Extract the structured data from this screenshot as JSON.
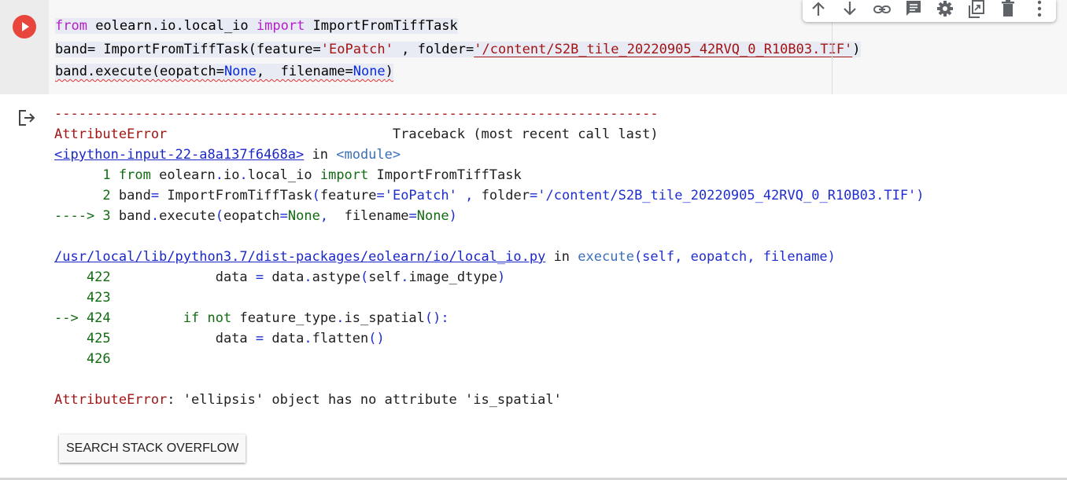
{
  "code_cell": {
    "lines": [
      [
        {
          "t": "from",
          "c": "kw"
        },
        {
          "t": " eolearn.io.local_io ",
          "c": "plain"
        },
        {
          "t": "import",
          "c": "kw"
        },
        {
          "t": " ImportFromTiffTask",
          "c": "plain"
        }
      ],
      [
        {
          "t": "band= ImportFromTiffTask(feature=",
          "c": "plain"
        },
        {
          "t": "'EoPatch'",
          "c": "str"
        },
        {
          "t": " , folder=",
          "c": "plain"
        },
        {
          "t": "'/content/S2B_tile_20220905_42RVQ_0_R10B03.TIF'",
          "c": "str err-ul"
        },
        {
          "t": ")",
          "c": "plain"
        }
      ],
      [
        {
          "t": "band.execute(eopatch=",
          "c": "plain squig"
        },
        {
          "t": "None",
          "c": "none squig"
        },
        {
          "t": ",  filename=",
          "c": "plain squig"
        },
        {
          "t": "None",
          "c": "none squig"
        },
        {
          "t": ")",
          "c": "plain squig"
        }
      ]
    ]
  },
  "toolbar": {
    "icons": [
      "arrow-up-icon",
      "arrow-down-icon",
      "link-icon",
      "comment-icon",
      "gear-icon",
      "mirror-cell-icon",
      "trash-icon",
      "more-vert-icon"
    ]
  },
  "output": {
    "lines": [
      [
        {
          "t": "---------------------------------------------------------------------------",
          "c": "o-red"
        }
      ],
      [
        {
          "t": "AttributeError",
          "c": "o-red"
        },
        {
          "t": "                            Traceback (most recent call last)",
          "c": "o-dark"
        }
      ],
      [
        {
          "t": "<ipython-input-22-a8a137f6468a>",
          "c": "o-link"
        },
        {
          "t": " in ",
          "c": "o-dark"
        },
        {
          "t": "<module>",
          "c": "o-teal"
        }
      ],
      [
        {
          "t": "      1 ",
          "c": "o-green"
        },
        {
          "t": "from",
          "c": "o-green"
        },
        {
          "t": " eolearn",
          "c": "o-dark"
        },
        {
          "t": ".",
          "c": "o-blue"
        },
        {
          "t": "io",
          "c": "o-dark"
        },
        {
          "t": ".",
          "c": "o-blue"
        },
        {
          "t": "local_io ",
          "c": "o-dark"
        },
        {
          "t": "import",
          "c": "o-green"
        },
        {
          "t": " ImportFromTiffTask",
          "c": "o-dark"
        }
      ],
      [
        {
          "t": "      2 ",
          "c": "o-green"
        },
        {
          "t": "band",
          "c": "o-dark"
        },
        {
          "t": "=",
          "c": "o-blue"
        },
        {
          "t": " ImportFromTiffTask",
          "c": "o-dark"
        },
        {
          "t": "(",
          "c": "o-blue"
        },
        {
          "t": "feature",
          "c": "o-dark"
        },
        {
          "t": "=",
          "c": "o-blue"
        },
        {
          "t": "'EoPatch'",
          "c": "o-blue"
        },
        {
          "t": " ",
          "c": "o-dark"
        },
        {
          "t": ",",
          "c": "o-blue"
        },
        {
          "t": " folder",
          "c": "o-dark"
        },
        {
          "t": "=",
          "c": "o-blue"
        },
        {
          "t": "'/content/S2B_tile_20220905_42RVQ_0_R10B03.TIF'",
          "c": "o-blue"
        },
        {
          "t": ")",
          "c": "o-blue"
        }
      ],
      [
        {
          "t": "----> 3 ",
          "c": "o-green"
        },
        {
          "t": "band",
          "c": "o-dark"
        },
        {
          "t": ".",
          "c": "o-blue"
        },
        {
          "t": "execute",
          "c": "o-dark"
        },
        {
          "t": "(",
          "c": "o-blue"
        },
        {
          "t": "eopatch",
          "c": "o-dark"
        },
        {
          "t": "=",
          "c": "o-blue"
        },
        {
          "t": "None",
          "c": "o-green"
        },
        {
          "t": ",",
          "c": "o-blue"
        },
        {
          "t": "  filename",
          "c": "o-dark"
        },
        {
          "t": "=",
          "c": "o-blue"
        },
        {
          "t": "None",
          "c": "o-green"
        },
        {
          "t": ")",
          "c": "o-blue"
        }
      ],
      [],
      [
        {
          "t": "/usr/local/lib/python3.7/dist-packages/eolearn/io/local_io.py",
          "c": "o-link"
        },
        {
          "t": " in ",
          "c": "o-dark"
        },
        {
          "t": "execute",
          "c": "o-teal"
        },
        {
          "t": "(self, eopatch, filename)",
          "c": "o-blue"
        }
      ],
      [
        {
          "t": "    422 ",
          "c": "o-green"
        },
        {
          "t": "            data ",
          "c": "o-dark"
        },
        {
          "t": "=",
          "c": "o-blue"
        },
        {
          "t": " data",
          "c": "o-dark"
        },
        {
          "t": ".",
          "c": "o-blue"
        },
        {
          "t": "astype",
          "c": "o-dark"
        },
        {
          "t": "(",
          "c": "o-blue"
        },
        {
          "t": "self",
          "c": "o-dark"
        },
        {
          "t": ".",
          "c": "o-blue"
        },
        {
          "t": "image_dtype",
          "c": "o-dark"
        },
        {
          "t": ")",
          "c": "o-blue"
        }
      ],
      [
        {
          "t": "    423 ",
          "c": "o-green"
        }
      ],
      [
        {
          "t": "--> 424 ",
          "c": "o-green"
        },
        {
          "t": "        ",
          "c": "o-dark"
        },
        {
          "t": "if",
          "c": "o-green"
        },
        {
          "t": " ",
          "c": "o-dark"
        },
        {
          "t": "not",
          "c": "o-green"
        },
        {
          "t": " feature_type",
          "c": "o-dark"
        },
        {
          "t": ".",
          "c": "o-blue"
        },
        {
          "t": "is_spatial",
          "c": "o-dark"
        },
        {
          "t": "():",
          "c": "o-blue"
        }
      ],
      [
        {
          "t": "    425 ",
          "c": "o-green"
        },
        {
          "t": "            data ",
          "c": "o-dark"
        },
        {
          "t": "=",
          "c": "o-blue"
        },
        {
          "t": " data",
          "c": "o-dark"
        },
        {
          "t": ".",
          "c": "o-blue"
        },
        {
          "t": "flatten",
          "c": "o-dark"
        },
        {
          "t": "()",
          "c": "o-blue"
        }
      ],
      [
        {
          "t": "    426 ",
          "c": "o-green"
        }
      ],
      [],
      [
        {
          "t": "AttributeError",
          "c": "o-red"
        },
        {
          "t": ": 'ellipsis' object has no attribute 'is_spatial'",
          "c": "o-dark"
        }
      ]
    ],
    "so_button_label": "SEARCH STACK OVERFLOW"
  }
}
